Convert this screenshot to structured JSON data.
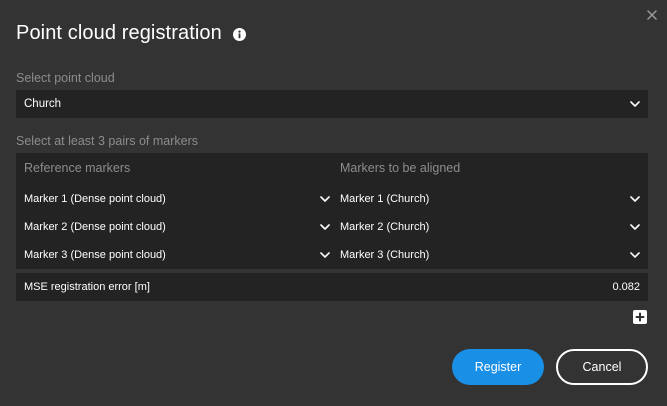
{
  "dialog": {
    "title": "Point cloud registration",
    "close_icon": "close-icon",
    "info_icon": "info-icon"
  },
  "point_cloud": {
    "label": "Select point cloud",
    "selected": "Church"
  },
  "markers": {
    "label": "Select at least 3 pairs of markers",
    "reference_header": "Reference markers",
    "aligned_header": "Markers to be aligned",
    "pairs": [
      {
        "reference": "Marker 1 (Dense point cloud)",
        "aligned": "Marker 1 (Church)"
      },
      {
        "reference": "Marker 2 (Dense point cloud)",
        "aligned": "Marker 2 (Church)"
      },
      {
        "reference": "Marker 3 (Dense point cloud)",
        "aligned": "Marker 3 (Church)"
      }
    ]
  },
  "mse": {
    "label": "MSE registration error [m]",
    "value": "0.082"
  },
  "actions": {
    "add_icon": "add-icon",
    "register_label": "Register",
    "cancel_label": "Cancel"
  },
  "colors": {
    "background": "#333333",
    "field": "#232323",
    "accent": "#1a8fe6",
    "muted_text": "#8c8c8c"
  }
}
